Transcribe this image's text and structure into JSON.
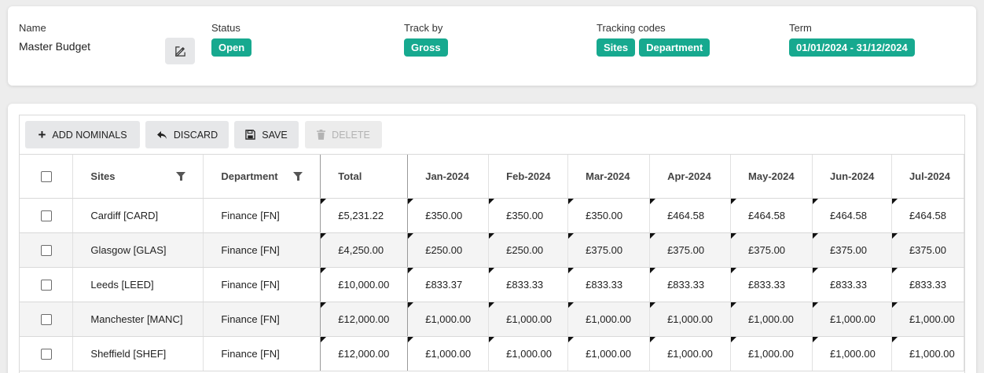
{
  "header": {
    "name_label": "Name",
    "name_value": "Master Budget",
    "status_label": "Status",
    "status_value": "Open",
    "track_label": "Track by",
    "track_value": "Gross",
    "codes_label": "Tracking codes",
    "codes": [
      "Sites",
      "Department"
    ],
    "term_label": "Term",
    "term_value": "01/01/2024 - 31/12/2024"
  },
  "toolbar": {
    "add_label": "ADD NOMINALS",
    "discard_label": "DISCARD",
    "save_label": "SAVE",
    "delete_label": "DELETE"
  },
  "table": {
    "columns": [
      "Sites",
      "Department",
      "Total",
      "Jan-2024",
      "Feb-2024",
      "Mar-2024",
      "Apr-2024",
      "May-2024",
      "Jun-2024",
      "Jul-2024"
    ],
    "rows": [
      {
        "site": "Cardiff [CARD]",
        "dept": "Finance [FN]",
        "total": "£5,231.22",
        "months": [
          "£350.00",
          "£350.00",
          "£350.00",
          "£464.58",
          "£464.58",
          "£464.58",
          "£464.58"
        ]
      },
      {
        "site": "Glasgow [GLAS]",
        "dept": "Finance [FN]",
        "total": "£4,250.00",
        "months": [
          "£250.00",
          "£250.00",
          "£375.00",
          "£375.00",
          "£375.00",
          "£375.00",
          "£375.00"
        ]
      },
      {
        "site": "Leeds [LEED]",
        "dept": "Finance [FN]",
        "total": "£10,000.00",
        "months": [
          "£833.37",
          "£833.33",
          "£833.33",
          "£833.33",
          "£833.33",
          "£833.33",
          "£833.33"
        ]
      },
      {
        "site": "Manchester [MANC]",
        "dept": "Finance [FN]",
        "total": "£12,000.00",
        "months": [
          "£1,000.00",
          "£1,000.00",
          "£1,000.00",
          "£1,000.00",
          "£1,000.00",
          "£1,000.00",
          "£1,000.00"
        ]
      },
      {
        "site": "Sheffield [SHEF]",
        "dept": "Finance [FN]",
        "total": "£12,000.00",
        "months": [
          "£1,000.00",
          "£1,000.00",
          "£1,000.00",
          "£1,000.00",
          "£1,000.00",
          "£1,000.00",
          "£1,000.00"
        ]
      }
    ]
  },
  "colors": {
    "accent": "#17a98f"
  }
}
